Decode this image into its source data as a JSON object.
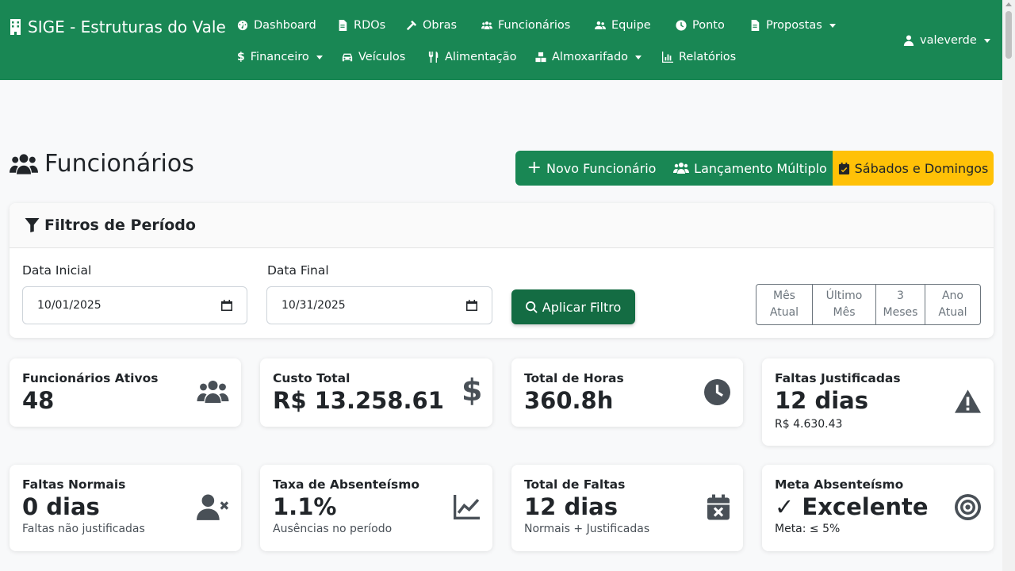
{
  "navbar": {
    "brand": "SIGE - Estruturas do Vale",
    "items": [
      {
        "label": "Dashboard",
        "icon": "dashboard-icon"
      },
      {
        "label": "RDOs",
        "icon": "file-icon"
      },
      {
        "label": "Obras",
        "icon": "hammer-icon"
      },
      {
        "label": "Funcionários",
        "icon": "users-icon"
      },
      {
        "label": "Equipe",
        "icon": "user-group-icon"
      },
      {
        "label": "Ponto",
        "icon": "clock-icon"
      },
      {
        "label": "Propostas",
        "icon": "file-icon",
        "dropdown": true
      },
      {
        "label": "Financeiro",
        "icon": "dollar-icon",
        "dropdown": true
      },
      {
        "label": "Veículos",
        "icon": "car-icon"
      },
      {
        "label": "Alimentação",
        "icon": "utensils-icon"
      },
      {
        "label": "Almoxarifado",
        "icon": "boxes-icon",
        "dropdown": true
      },
      {
        "label": "Relatórios",
        "icon": "chart-icon"
      }
    ],
    "user": "valeverde"
  },
  "page": {
    "title": "Funcionários",
    "actions": {
      "new_employee": "Novo Funcionário",
      "multi_entry": "Lançamento Múltiplo",
      "weekends": "Sábados e Domingos"
    }
  },
  "filters": {
    "title": "Filtros de Período",
    "start_label": "Data Inicial",
    "start_value": "10/01/2025",
    "end_label": "Data Final",
    "end_value": "10/31/2025",
    "apply_label": "Aplicar Filtro",
    "ranges": [
      {
        "line1": "Mês",
        "line2": "Atual"
      },
      {
        "line1": "Último",
        "line2": "Mês"
      },
      {
        "line1": "3",
        "line2": "Meses"
      },
      {
        "line1": "Ano",
        "line2": "Atual"
      }
    ]
  },
  "stats": {
    "active": {
      "label": "Funcionários Ativos",
      "value": "48"
    },
    "cost": {
      "label": "Custo Total",
      "value": "R$ 13.258.61"
    },
    "hours": {
      "label": "Total de Horas",
      "value": "360.8h"
    },
    "justified": {
      "label": "Faltas Justificadas",
      "value": "12 dias",
      "sub": "R$ 4.630.43"
    },
    "normal": {
      "label": "Faltas Normais",
      "value": "0 dias",
      "sub": "Faltas não justificadas"
    },
    "absenteeism": {
      "label": "Taxa de Absenteísmo",
      "value": "1.1%",
      "sub": "Ausências no período"
    },
    "total_absences": {
      "label": "Total de Faltas",
      "value": "12 dias",
      "sub": "Normais + Justificadas"
    },
    "goal": {
      "label": "Meta Absenteísmo",
      "value": "✓ Excelente",
      "sub": "Meta: ≤ 5%"
    }
  },
  "colors": {
    "primary": "#198754",
    "primary_dark": "#146c43",
    "warning": "#ffc107",
    "icon_gray": "#495057"
  }
}
